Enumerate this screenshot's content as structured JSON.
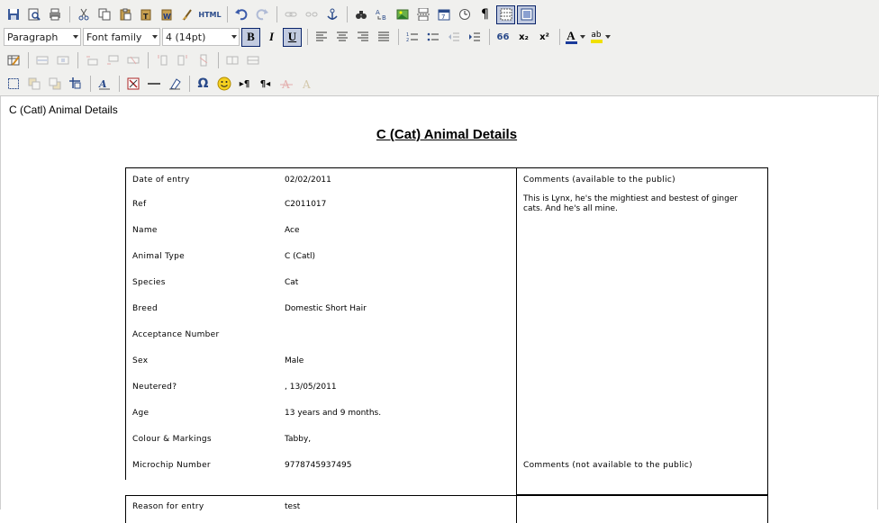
{
  "toolbar": {
    "format_select": "Paragraph",
    "font_family_select": "Font family",
    "font_size_select": "4 (14pt)",
    "html_label": "HTML",
    "pilcrow": "¶",
    "bold": "B",
    "italic": "I",
    "underline": "U",
    "blockquote": "66",
    "subscript": "x₂",
    "superscript": "x²",
    "omega": "Ω",
    "font_color": "A",
    "highlight": "ab",
    "ltr": "▸¶",
    "rtl": "¶◂"
  },
  "document": {
    "label": "C (Catl) Animal Details",
    "title": "C (Cat) Animal Details"
  },
  "fields": [
    {
      "label": "Date of entry",
      "value": "02/02/2011"
    },
    {
      "label": "Ref",
      "value": "C2011017"
    },
    {
      "label": "Name",
      "value": "Ace"
    },
    {
      "label": "Animal Type",
      "value": "C (Catl)"
    },
    {
      "label": "Species",
      "value": "Cat"
    },
    {
      "label": "Breed",
      "value": "Domestic Short Hair"
    },
    {
      "label": "Acceptance Number",
      "value": ""
    },
    {
      "label": "Sex",
      "value": "Male"
    },
    {
      "label": "Neutered?",
      "value": ", 13/05/2011"
    },
    {
      "label": "Age",
      "value": "13 years and 9 months."
    },
    {
      "label": "Colour & Markings",
      "value": "Tabby,"
    },
    {
      "label": "Microchip Number",
      "value": "9778745937495"
    }
  ],
  "comments_public": {
    "heading": "Comments (available to the public)",
    "text": "This is Lynx, he's the mightiest and bestest of ginger cats. And he's all mine."
  },
  "comments_private": {
    "heading": "Comments (not available to the public)"
  },
  "second_table": {
    "label": "Reason for entry",
    "value": "test"
  }
}
